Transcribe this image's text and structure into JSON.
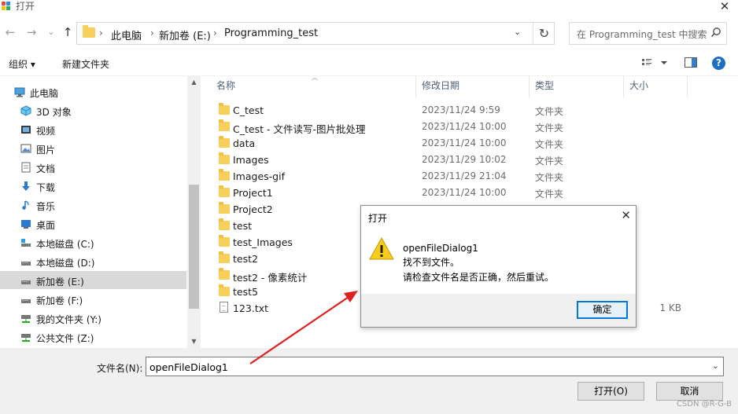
{
  "window": {
    "title": "打开",
    "close_glyph": "✕"
  },
  "nav": {
    "back": "←",
    "forward": "→",
    "recent": "⌄",
    "up": "↑"
  },
  "address": {
    "crumbs": [
      "此电脑",
      "新加卷 (E:)",
      "Programming_test"
    ],
    "separator": "›",
    "dropdown": "⌄",
    "refresh": "↻"
  },
  "search": {
    "placeholder": "在 Programming_test 中搜索",
    "icon": "search-icon"
  },
  "toolbar": {
    "organize": "组织 ▾",
    "new_folder": "新建文件夹",
    "view_icon": "view-options-icon",
    "pane_icon": "preview-pane-icon",
    "help": "?"
  },
  "sidebar": {
    "items": [
      {
        "label": "此电脑",
        "icon": "pc-icon"
      },
      {
        "label": "3D 对象",
        "icon": "3d-objects-icon"
      },
      {
        "label": "视频",
        "icon": "video-icon"
      },
      {
        "label": "图片",
        "icon": "pictures-icon"
      },
      {
        "label": "文档",
        "icon": "documents-icon"
      },
      {
        "label": "下载",
        "icon": "download-icon"
      },
      {
        "label": "音乐",
        "icon": "music-icon"
      },
      {
        "label": "桌面",
        "icon": "desktop-icon"
      },
      {
        "label": "本地磁盘 (C:)",
        "icon": "drive-c-icon"
      },
      {
        "label": "本地磁盘 (D:)",
        "icon": "drive-icon"
      },
      {
        "label": "新加卷 (E:)",
        "icon": "drive-icon",
        "selected": true
      },
      {
        "label": "新加卷 (F:)",
        "icon": "drive-icon"
      },
      {
        "label": "我的文件夹 (Y:)",
        "icon": "network-drive-icon"
      },
      {
        "label": "公共文件 (Z:)",
        "icon": "network-drive-icon"
      }
    ]
  },
  "columns": {
    "name": "名称",
    "date": "修改日期",
    "type": "类型",
    "size": "大小"
  },
  "files": [
    {
      "name": "C_test",
      "date": "2023/11/24 9:59",
      "type": "文件夹",
      "size": ""
    },
    {
      "name": "C_test - 文件读写-图片批处理",
      "date": "2023/11/24 10:00",
      "type": "文件夹",
      "size": ""
    },
    {
      "name": "data",
      "date": "2023/11/24 10:00",
      "type": "文件夹",
      "size": ""
    },
    {
      "name": "Images",
      "date": "2023/11/29 10:02",
      "type": "文件夹",
      "size": ""
    },
    {
      "name": "Images-gif",
      "date": "2023/11/29 21:04",
      "type": "文件夹",
      "size": ""
    },
    {
      "name": "Project1",
      "date": "2023/11/24 10:00",
      "type": "文件夹",
      "size": ""
    },
    {
      "name": "Project2",
      "date": "",
      "type": "",
      "size": ""
    },
    {
      "name": "test",
      "date": "",
      "type": "",
      "size": ""
    },
    {
      "name": "test_Images",
      "date": "",
      "type": "",
      "size": ""
    },
    {
      "name": "test2",
      "date": "",
      "type": "",
      "size": ""
    },
    {
      "name": "test2 - 像素统计",
      "date": "",
      "type": "",
      "size": ""
    },
    {
      "name": "test5",
      "date": "",
      "type": "",
      "size": ""
    },
    {
      "name": "123.txt",
      "date": "",
      "type": "",
      "size": "1 KB",
      "is_file": true
    }
  ],
  "bottom": {
    "filename_label": "文件名(N):",
    "filename_value": "openFileDialog1",
    "open_button": "打开(O)",
    "open_dropdown": "▾",
    "cancel_button": "取消",
    "watermark": "CSDN @R-G-B"
  },
  "message_box": {
    "title": "打开",
    "close_glyph": "✕",
    "lines": [
      "openFileDialog1",
      "找不到文件。",
      "请检查文件名是否正确，然后重试。"
    ],
    "ok_button": "确定",
    "icon": "warning-icon"
  },
  "colors": {
    "accent": "#0078d7",
    "folder": "#f7d05b",
    "annotation_arrow": "#e02020",
    "selected": "#d9d9d9"
  }
}
